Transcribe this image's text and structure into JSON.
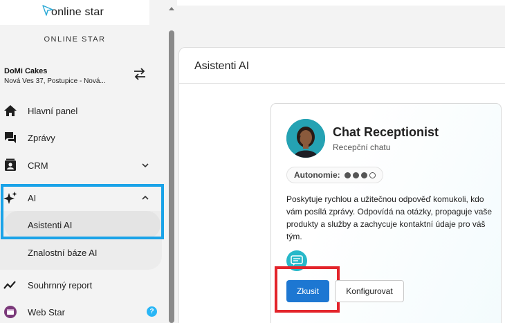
{
  "brand": {
    "logo_text": "online star",
    "label": "ONLINE STAR"
  },
  "account": {
    "name": "DoMi Cakes",
    "address": "Nová Ves 37, Postupice - Nová..."
  },
  "nav": {
    "dashboard": "Hlavní panel",
    "messages": "Zprávy",
    "crm": "CRM",
    "ai": "AI",
    "ai_assistants": "Asistenti AI",
    "ai_knowledge": "Znalostní báze AI",
    "summary_report": "Souhrnný report",
    "web_star": "Web Star",
    "help_badge": "?"
  },
  "page": {
    "title": "Asistenti AI"
  },
  "card": {
    "title": "Chat Receptionist",
    "subtitle": "Recepční chatu",
    "autonomy_label": "Autonomie:",
    "autonomy_level": 3,
    "autonomy_max": 4,
    "description": "Poskytuje rychlou a užitečnou odpověď komukoli, kdo vám posílá zprávy. Odpovídá na otázky, propaguje vaše produkty a služby a zachycuje kontaktní údaje pro váš tým.",
    "try_label": "Zkusit",
    "configure_label": "Konfigurovat"
  },
  "colors": {
    "primary_button": "#1d77d2",
    "ai_highlight": "#1aa3e8",
    "try_highlight": "#e3242b",
    "channel_icon": "#27b8c9"
  }
}
